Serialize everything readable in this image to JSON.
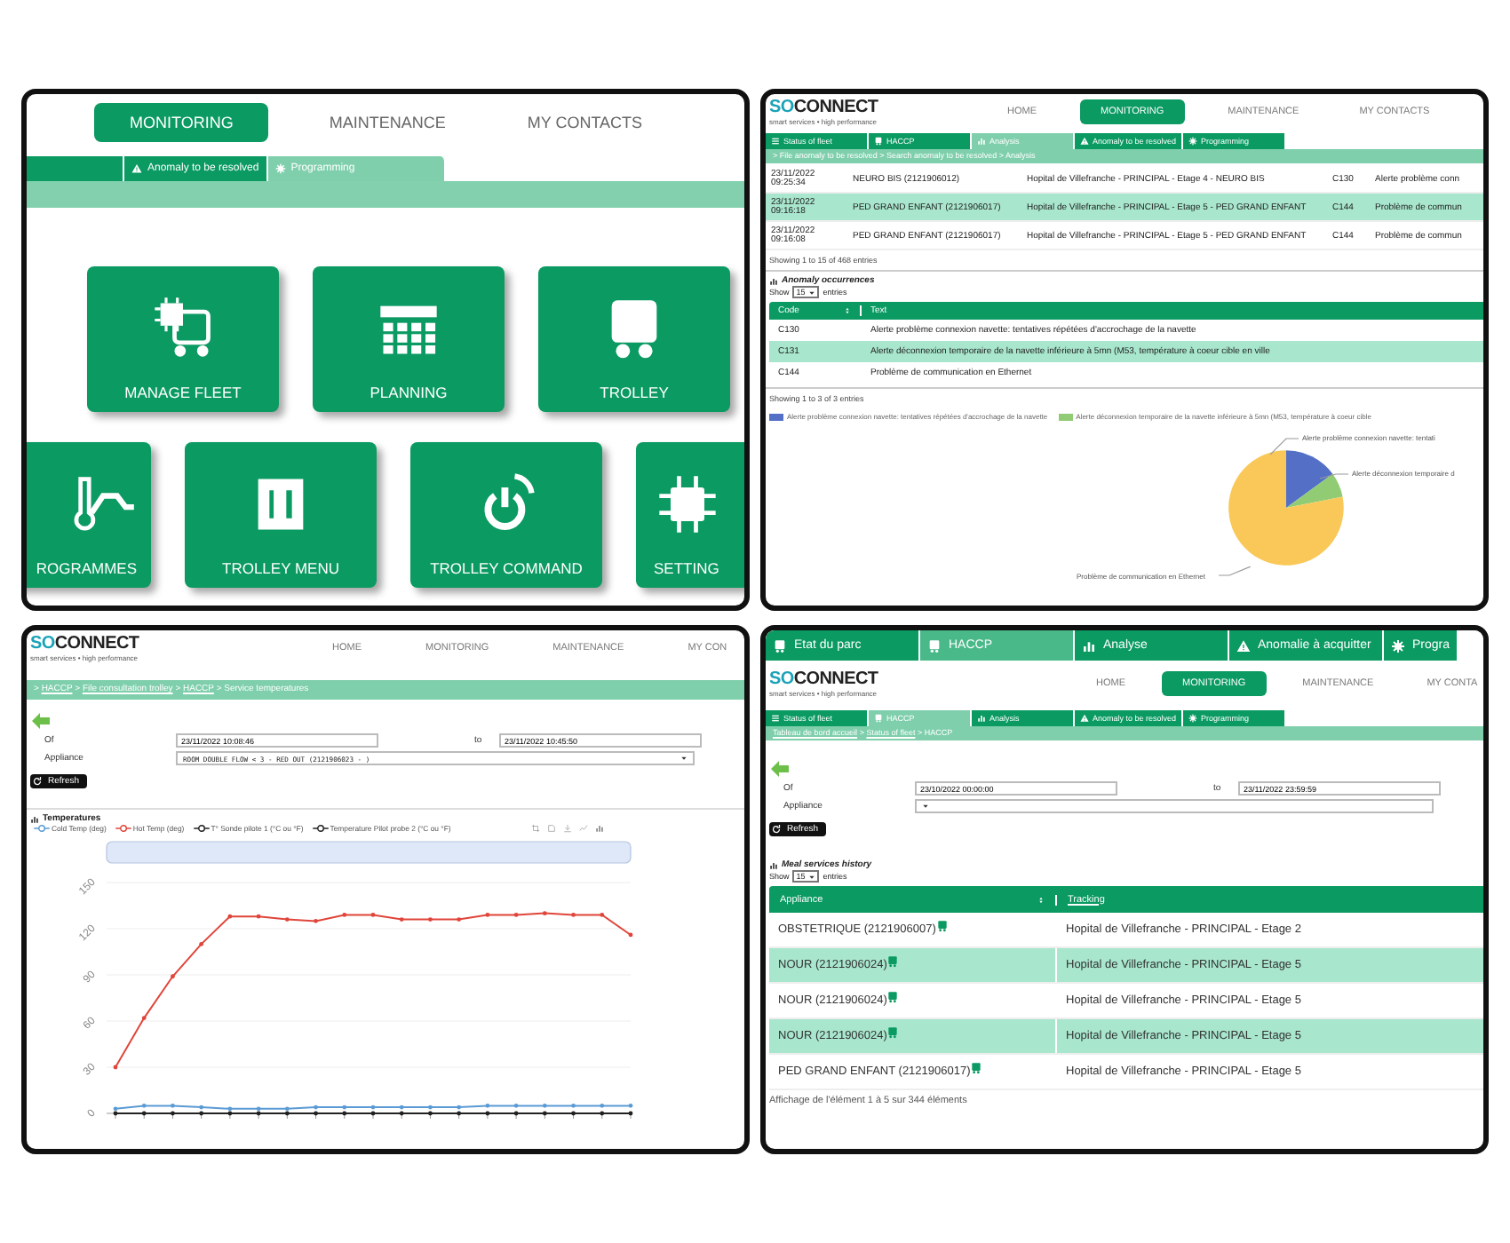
{
  "dashboard": {
    "nav": [
      {
        "label": "MONITORING",
        "selected": true
      },
      {
        "label": "MAINTENANCE",
        "selected": false
      },
      {
        "label": "MY CONTACTS",
        "selected": false
      }
    ],
    "subtabs": [
      {
        "label": "Anomaly to be resolved",
        "kind": "warning",
        "selected": false
      },
      {
        "label": "Programming",
        "kind": "gear",
        "selected": true
      }
    ],
    "tile_rows": [
      {
        "tiles": [
          {
            "label": "MANAGE FLEET",
            "kind": "fleet"
          },
          {
            "label": "PLANNING",
            "kind": "calendar"
          },
          {
            "label": "TROLLEY",
            "kind": "trolley"
          }
        ]
      },
      {
        "tiles": [
          {
            "label": "ROGRAMMES",
            "kind": "programme"
          },
          {
            "label": "TROLLEY MENU",
            "kind": "menu"
          },
          {
            "label": "TROLLEY COMMAND",
            "kind": "command"
          },
          {
            "label": "SETTING",
            "kind": "chip"
          }
        ]
      }
    ]
  },
  "analysis_screen": {
    "logo": {
      "prefix": "SO",
      "name": "CONNECT",
      "tagline": "smart services • high performance"
    },
    "nav": [
      {
        "label": "HOME",
        "selected": false
      },
      {
        "label": "MONITORING",
        "selected": true
      },
      {
        "label": "MAINTENANCE",
        "selected": false
      },
      {
        "label": "MY CONTACTS",
        "selected": false
      }
    ],
    "subtabs": [
      {
        "label": "Status of fleet",
        "kind": "list",
        "selected": false
      },
      {
        "label": "HACCP",
        "kind": "trolley",
        "selected": false
      },
      {
        "label": "Analysis",
        "kind": "chart",
        "selected": true
      },
      {
        "label": "Anomaly to be resolved",
        "kind": "warning",
        "selected": false
      },
      {
        "label": "Programming",
        "kind": "gear",
        "selected": false
      }
    ],
    "breadcrumb": [
      {
        "text": "> File anomaly to be resolved > Search anomaly to be resolved > Analysis",
        "link": false
      }
    ],
    "events": [
      {
        "timestamp": "23/11/2022 09:25:34",
        "appliance": "NEURO BIS (2121906012)",
        "location": "Hopital de Villefranche - PRINCIPAL - Etage 4 - NEURO BIS",
        "code": "C130",
        "text": "Alerte problème conn"
      },
      {
        "timestamp": "23/11/2022 09:16:18",
        "appliance": "PED GRAND ENFANT (2121906017)",
        "location": "Hopital de Villefranche - PRINCIPAL - Etage 5 - PED GRAND ENFANT",
        "code": "C144",
        "text": "Problème de commun"
      },
      {
        "timestamp": "23/11/2022 09:16:08",
        "appliance": "PED GRAND ENFANT (2121906017)",
        "location": "Hopital de Villefranche - PRINCIPAL - Etage 5 - PED GRAND ENFANT",
        "code": "C144",
        "text": "Problème de commun"
      }
    ],
    "events_footer": "Showing 1 to 15 of 468 entries",
    "occurrences": {
      "title": "Anomaly occurrences",
      "show_label": "Show",
      "page_size": "15",
      "entries_label": "entries",
      "columns": [
        "Code",
        "Text"
      ],
      "rows": [
        {
          "code": "C130",
          "text": "Alerte problème connexion navette: tentatives répétées d'accrochage de la navette"
        },
        {
          "code": "C131",
          "text": "Alerte déconnexion temporaire de la navette inférieure à 5mn (M53, température à coeur cible en ville"
        },
        {
          "code": "C144",
          "text": "Problème de communication en Ethernet"
        }
      ],
      "footer": "Showing 1 to 3 of 3 entries",
      "legend": [
        {
          "label": "Alerte problème connexion navette: tentatives répétées d'accrochage de la navette",
          "color": "#5470c6"
        },
        {
          "label": "Alerte déconnexion temporaire de la navette inférieure à 5mn (M53, température à coeur cible",
          "color": "#91cc75"
        }
      ],
      "slices": [
        {
          "label": "Alerte problème connexion navette: tentati",
          "color": "#5470c6"
        },
        {
          "label": "Alerte déconnexion temporaire d",
          "color": "#91cc75"
        },
        {
          "label": "Problème de communication en Ethernet",
          "color": "#fac858"
        }
      ]
    }
  },
  "temperature_screen": {
    "logo": {
      "prefix": "SO",
      "name": "CONNECT",
      "tagline": "smart services • high performance"
    },
    "nav": [
      {
        "label": "HOME",
        "selected": false
      },
      {
        "label": "MONITORING",
        "selected": false
      },
      {
        "label": "MAINTENANCE",
        "selected": false
      },
      {
        "label": "MY CON",
        "selected": false
      }
    ],
    "breadcrumb": [
      {
        "text": ">",
        "link": false
      },
      {
        "text": "HACCP",
        "link": true
      },
      {
        "text": ">",
        "link": false
      },
      {
        "text": "File consultation trolley",
        "link": true
      },
      {
        "text": ">",
        "link": false
      },
      {
        "text": "HACCP",
        "link": true
      },
      {
        "text": "> Service temperatures",
        "link": false
      }
    ],
    "form": {
      "from_label": "Of",
      "from_value": "23/11/2022 10:08:46",
      "to_label": "to",
      "to_value": "23/11/2022 10:45:50",
      "appliance_label": "Appliance",
      "appliance_value": "ROOM DOUBLE FLOW < 3 - RED OUT (2121906023 - )"
    },
    "refresh": "Refresh",
    "section_title": "Temperatures",
    "chart_data": {
      "type": "line",
      "grid": true,
      "ylim": [
        0,
        150
      ],
      "yticks": [
        0,
        30,
        60,
        90,
        120,
        150
      ],
      "series": [
        {
          "name": "Cold Temp (deg)",
          "color": "#5b9bd5",
          "values": [
            3,
            5,
            5,
            4,
            3,
            3,
            3,
            4,
            4,
            4,
            4,
            4,
            4,
            5,
            5,
            5,
            5,
            5,
            5
          ]
        },
        {
          "name": "Hot Temp (deg)",
          "color": "#e0453a",
          "values": [
            30,
            62,
            89,
            110,
            128,
            128,
            126,
            125,
            129,
            129,
            126,
            126,
            126,
            129,
            129,
            130,
            129,
            129,
            116
          ]
        },
        {
          "name": "T° Sonde pilote 1 (°C ou °F)",
          "color": "#222222",
          "values": [
            0,
            0,
            0,
            0,
            0,
            0,
            0,
            0,
            0,
            0,
            0,
            0,
            0,
            0,
            0,
            0,
            0,
            0,
            0
          ]
        },
        {
          "name": "Temperature Pilot probe 2 (°C ou °F)",
          "color": "#222222",
          "values": [
            null,
            null,
            null,
            null,
            null,
            null,
            null,
            null,
            null,
            null,
            null,
            null,
            null,
            null,
            null,
            null,
            null,
            null,
            null
          ]
        }
      ]
    }
  },
  "haccp_screen": {
    "top_tabs": [
      {
        "label": "Etat du parc",
        "kind": "trolley",
        "selected": false
      },
      {
        "label": "HACCP",
        "kind": "trolley",
        "selected": true
      },
      {
        "label": "Analyse",
        "kind": "chart",
        "selected": false
      },
      {
        "label": "Anomalie à acquitter",
        "kind": "warning",
        "selected": false
      },
      {
        "label": "Progra",
        "kind": "gear",
        "selected": false
      }
    ],
    "logo": {
      "prefix": "SO",
      "name": "CONNECT",
      "tagline": "smart services • high performance"
    },
    "nav": [
      {
        "label": "HOME",
        "selected": false
      },
      {
        "label": "MONITORING",
        "selected": true
      },
      {
        "label": "MAINTENANCE",
        "selected": false
      },
      {
        "label": "MY CONTA",
        "selected": false
      }
    ],
    "subtabs": [
      {
        "label": "Status of fleet",
        "kind": "list",
        "selected": false
      },
      {
        "label": "HACCP",
        "kind": "trolley",
        "selected": true
      },
      {
        "label": "Analysis",
        "kind": "chart",
        "selected": false
      },
      {
        "label": "Anomaly to be resolved",
        "kind": "warning",
        "selected": false
      },
      {
        "label": "Programming",
        "kind": "gear",
        "selected": false
      }
    ],
    "breadcrumb": [
      {
        "text": "Tableau de bord accueil",
        "link": true
      },
      {
        "text": ">",
        "link": false
      },
      {
        "text": "Status of fleet",
        "link": true
      },
      {
        "text": "> HACCP",
        "link": false
      }
    ],
    "form": {
      "from_label": "Of",
      "from_value": "23/10/2022 00:00:00",
      "to_label": "to",
      "to_value": "23/11/2022 23:59:59",
      "appliance_label": "Appliance"
    },
    "refresh": "Refresh",
    "section_title": "Meal services history",
    "show_label": "Show",
    "page_size": "15",
    "entries_label": "entries",
    "columns": [
      "Appliance",
      "Tracking"
    ],
    "rows": [
      {
        "appliance": "OBSTETRIQUE (2121906007)",
        "location": "Hopital de Villefranche - PRINCIPAL - Etage 2"
      },
      {
        "appliance": "NOUR (2121906024)",
        "location": "Hopital de Villefranche - PRINCIPAL - Etage 5"
      },
      {
        "appliance": "NOUR (2121906024)",
        "location": "Hopital de Villefranche - PRINCIPAL - Etage 5"
      },
      {
        "appliance": "NOUR (2121906024)",
        "location": "Hopital de Villefranche - PRINCIPAL - Etage 5"
      },
      {
        "appliance": "PED GRAND ENFANT (2121906017)",
        "location": "Hopital de Villefranche - PRINCIPAL - Etage 5"
      }
    ],
    "footer": "Affichage de l'élément 1 à 5 sur 344 éléments"
  }
}
